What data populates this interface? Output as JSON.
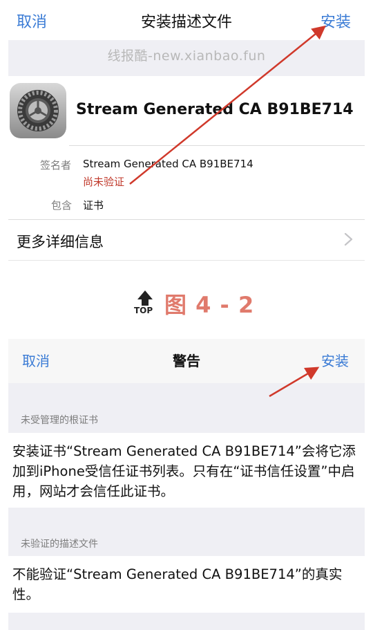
{
  "screen1": {
    "cancel_label": "取消",
    "title": "安装描述文件",
    "install_label": "安装",
    "watermark": "线报酷-new.xianbao.fun",
    "profile_name": "Stream Generated CA B91BE714",
    "signed_by_label": "签名者",
    "signed_by_value": "Stream Generated CA B91BE714",
    "unverified_text": "尚未验证",
    "contains_label": "包含",
    "contains_value": "证书",
    "more_details_label": "更多详细信息"
  },
  "figure": {
    "top_label": "TOP",
    "caption": "图 4 - 2"
  },
  "screen2": {
    "cancel_label": "取消",
    "title": "警告",
    "install_label": "安装",
    "section1_header": "未受管理的根证书",
    "section1_text": "安装证书“Stream Generated CA B91BE714”会将它添加到iPhone受信任证书列表。只有在“证书信任设置”中启用，网站才会信任此证书。",
    "section2_header": "未验证的描述文件",
    "section2_text": "不能验证“Stream Generated CA B91BE714”的真实性。"
  },
  "colors": {
    "accent_blue": "#3a7bd5",
    "warning_red": "#c0392b",
    "annotation_red": "#d0392b",
    "caption_color": "#e07a6c",
    "group_gray": "#efeff4"
  },
  "icons": {
    "profile": "settings-gear-icon",
    "more": "chevron-right-icon",
    "top": "up-arrow-icon"
  }
}
